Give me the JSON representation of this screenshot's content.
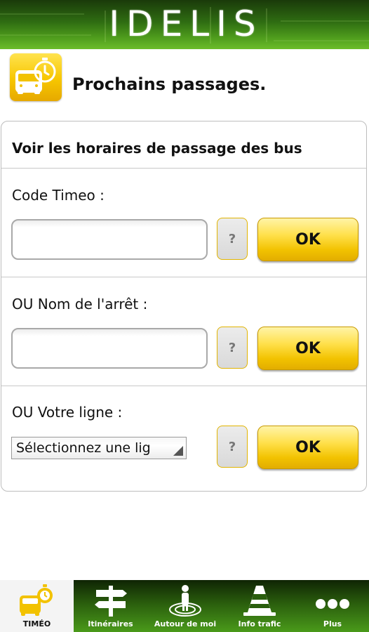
{
  "header": {
    "logo_text": "IDELIS"
  },
  "page": {
    "title": "Prochains passages."
  },
  "card": {
    "heading": "Voir les horaires de passage des bus",
    "sections": [
      {
        "label": "Code Timeo :",
        "input_value": "",
        "help_label": "?",
        "ok_label": "OK"
      },
      {
        "label": "OU Nom de l'arrêt :",
        "input_value": "",
        "help_label": "?",
        "ok_label": "OK"
      },
      {
        "label": "OU Votre ligne :",
        "select_value": "Sélectionnez une lig",
        "help_label": "?",
        "ok_label": "OK"
      }
    ]
  },
  "nav": {
    "items": [
      {
        "label": "TIMÉO",
        "icon": "bus-clock-icon",
        "active": true
      },
      {
        "label": "Itinéraires",
        "icon": "signpost-icon",
        "active": false
      },
      {
        "label": "Autour de moi",
        "icon": "person-location-icon",
        "active": false
      },
      {
        "label": "Info trafic",
        "icon": "traffic-cone-icon",
        "active": false
      },
      {
        "label": "Plus",
        "icon": "more-dots-icon",
        "active": false
      }
    ]
  },
  "colors": {
    "accent_yellow": "#f2c200",
    "header_green": "#4d9a1c",
    "nav_green": "#2a5e0d"
  }
}
